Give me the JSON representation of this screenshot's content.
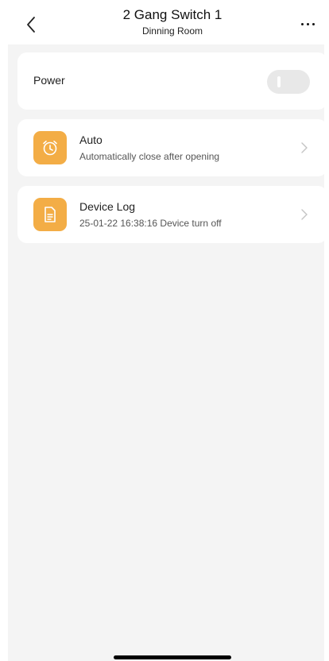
{
  "header": {
    "title": "2 Gang Switch 1",
    "subtitle": "Dinning Room",
    "back_icon": "chevron-left-icon",
    "more_icon": "more-horizontal-icon"
  },
  "power": {
    "label": "Power",
    "state": "off"
  },
  "rows": [
    {
      "icon": "alarm-clock-icon",
      "title": "Auto",
      "subtitle": "Automatically close after opening"
    },
    {
      "icon": "document-icon",
      "title": "Device Log",
      "subtitle": "25-01-22 16:38:16 Device turn off"
    }
  ],
  "colors": {
    "icon_bg": "#f3ad46",
    "screen_bg": "#f4f4f4",
    "card_bg": "#ffffff",
    "toggle_off": "#e8e8e8"
  }
}
